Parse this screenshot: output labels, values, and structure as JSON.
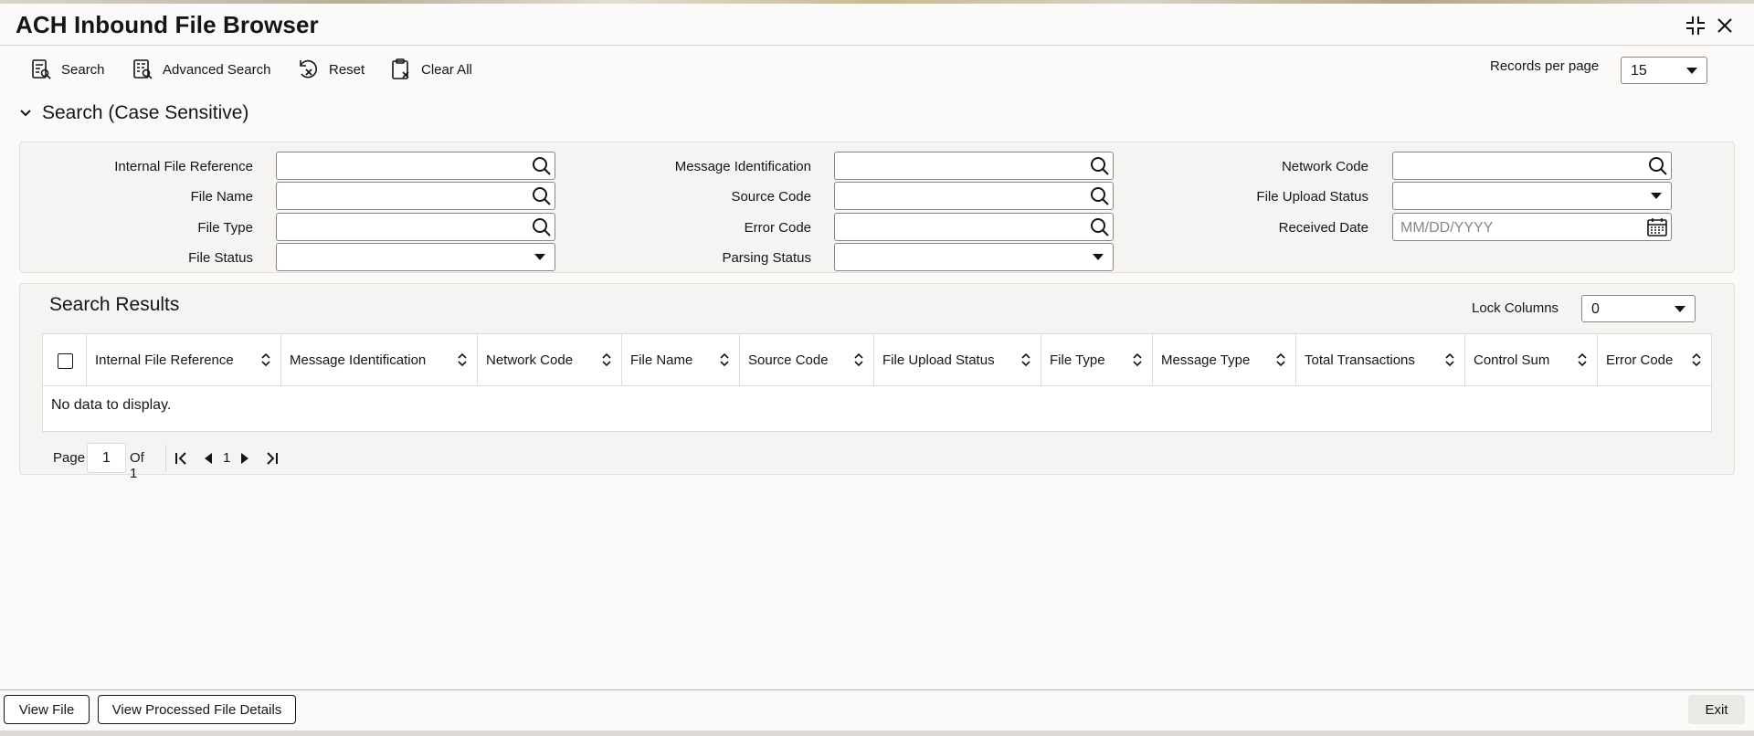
{
  "window": {
    "title": "ACH Inbound File Browser"
  },
  "toolbar": {
    "search": "Search",
    "advanced_search": "Advanced Search",
    "reset": "Reset",
    "clear_all": "Clear All",
    "records_per_page_label": "Records per page",
    "records_per_page_value": "15"
  },
  "search_section": {
    "title": "Search (Case Sensitive)",
    "fields": {
      "internal_file_reference": "Internal File Reference",
      "file_name": "File Name",
      "file_type": "File Type",
      "file_status": "File Status",
      "message_identification": "Message Identification",
      "source_code": "Source Code",
      "error_code": "Error Code",
      "parsing_status": "Parsing Status",
      "network_code": "Network Code",
      "file_upload_status": "File Upload Status",
      "received_date": "Received Date",
      "received_date_placeholder": "MM/DD/YYYY"
    }
  },
  "results": {
    "title": "Search Results",
    "lock_columns_label": "Lock Columns",
    "lock_columns_value": "0",
    "columns": [
      "Internal File Reference",
      "Message Identification",
      "Network Code",
      "File Name",
      "Source Code",
      "File Upload Status",
      "File Type",
      "Message Type",
      "Total Transactions",
      "Control Sum",
      "Error Code"
    ],
    "no_data": "No data to display."
  },
  "pagination": {
    "page_label": "Page",
    "current_page": "1",
    "of_label": "Of 1",
    "page_number": "1"
  },
  "footer": {
    "view_file": "View File",
    "view_processed": "View Processed File Details",
    "exit": "Exit"
  },
  "icons": {
    "search": "search-icon",
    "advanced_search": "advanced-search-icon",
    "reset": "reset-icon",
    "clear_all": "clear-all-icon",
    "collapse": "chevron-down-icon",
    "lookup": "magnifier-icon",
    "calendar": "calendar-icon",
    "sort": "sort-icon",
    "minimize": "compress-icon",
    "close": "close-icon"
  }
}
